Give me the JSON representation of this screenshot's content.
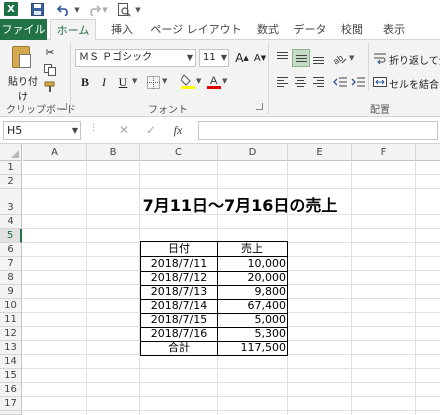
{
  "qat": {
    "app_icon": "X"
  },
  "tabs": [
    "ファイル",
    "ホーム",
    "挿入",
    "ページ レイアウト",
    "数式",
    "データ",
    "校閲",
    "表示"
  ],
  "ribbon": {
    "clipboard": {
      "paste_label": "貼り付け",
      "group_label": "クリップボード"
    },
    "font": {
      "font_name": "ＭＳ Ｐゴシック",
      "font_size": "11",
      "group_label": "フォント",
      "bold": "B",
      "italic": "I",
      "underline": "U",
      "grow": "A",
      "shrink": "A"
    },
    "alignment": {
      "wrap_text": "折り返して全",
      "merge_center": "セルを結合し",
      "group_label": "配置"
    }
  },
  "formula_bar": {
    "name_box": "H5",
    "fx": "fx",
    "formula": ""
  },
  "columns": [
    "A",
    "B",
    "C",
    "D",
    "E",
    "F"
  ],
  "rows": [
    "1",
    "2",
    "3",
    "4",
    "5",
    "6",
    "7",
    "8",
    "9",
    "10",
    "11",
    "12",
    "13",
    "14",
    "15",
    "16",
    "17"
  ],
  "selected_row": "5",
  "sheet": {
    "title": "7月11日～7月16日の売上",
    "header": {
      "date": "日付",
      "sales": "売上"
    },
    "records": [
      {
        "date": "2018/7/11",
        "sales": "10,000"
      },
      {
        "date": "2018/7/12",
        "sales": "20,000"
      },
      {
        "date": "2018/7/13",
        "sales": "9,800"
      },
      {
        "date": "2018/7/14",
        "sales": "67,400"
      },
      {
        "date": "2018/7/15",
        "sales": "5,000"
      },
      {
        "date": "2018/7/16",
        "sales": "5,300"
      }
    ],
    "total": {
      "label": "合計",
      "value": "117,500"
    }
  },
  "colors": {
    "excel_green": "#217346",
    "ribbon_bg": "#f3f3f3",
    "active_align": "#c5dbc5"
  }
}
